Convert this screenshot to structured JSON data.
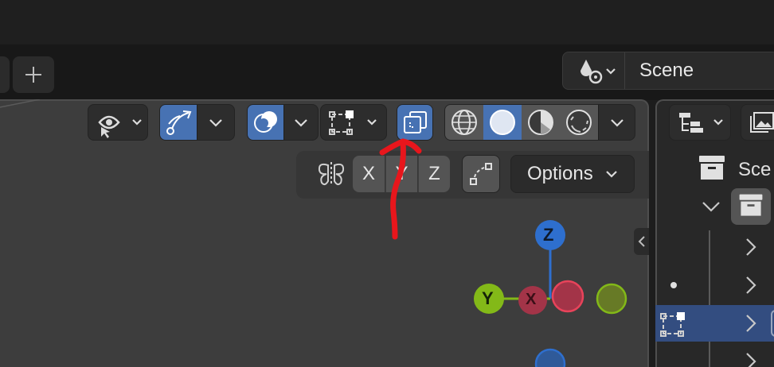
{
  "scene_selector": {
    "name": "Scene",
    "icon": "scene-data-icon"
  },
  "top_tabs": {
    "add_tab_icon": "plus-icon"
  },
  "viewport_header": {
    "visibility_icon": "eye-pointer-icon",
    "gizmo_icon": "transform-gizmo-icon",
    "overlay_icon": "overlay-icon",
    "edit_overlay_icon": "mesh-edit-icon",
    "xray_icon": "xray-toggle-icon",
    "shading_modes": [
      "wireframe",
      "solid",
      "material-preview",
      "rendered"
    ],
    "active_shading": "solid"
  },
  "sub_toolbar": {
    "mirror_icon": "mirror-butterfly-icon",
    "axes": [
      "X",
      "Y",
      "Z"
    ],
    "snap_icon": "auto-merge-icon",
    "options_label": "Options"
  },
  "gizmo": {
    "z_label": "Z",
    "y_label": "Y",
    "x_label": "X",
    "colors": {
      "z": "#2e6fce",
      "y": "#83b918",
      "x": "#e8435a",
      "x_neg": "#a33448",
      "y_neg": "#677a26"
    }
  },
  "outliner": {
    "partial_label": "Sce",
    "collection_icon": "collection-box-icon"
  },
  "annotation": {
    "color": "#e8161c",
    "description": "red arrow pointing to x-ray toggle"
  }
}
